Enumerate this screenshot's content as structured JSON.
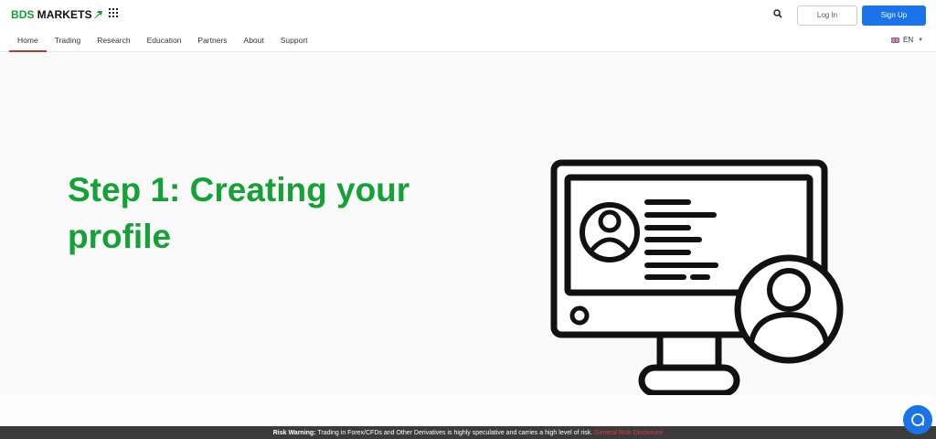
{
  "header": {
    "logo_primary": "BDS",
    "logo_secondary": "MARKETS",
    "login_label": "Log In",
    "signup_label": "Sign Up"
  },
  "nav": {
    "items": [
      {
        "label": "Home",
        "active": true
      },
      {
        "label": "Trading"
      },
      {
        "label": "Research"
      },
      {
        "label": "Education"
      },
      {
        "label": "Partners"
      },
      {
        "label": "About"
      },
      {
        "label": "Support"
      }
    ],
    "language": "EN"
  },
  "hero": {
    "headline": "Step 1: Creating your profile"
  },
  "footer": {
    "risk_label": "Risk Warning:",
    "risk_text": " Trading in Forex/CFDs and Other Derivatives is highly speculative and carries a high level of risk. ",
    "risk_link": "General Risk Disclosure"
  },
  "colors": {
    "brand_green": "#14a135",
    "primary_blue": "#1a73e8",
    "active_underline": "#c0392b",
    "footer_bg": "#3b3b3b"
  },
  "icons": [
    "apps-grid-icon",
    "search-icon",
    "uk-flag-icon",
    "chevron-down-icon",
    "chat-icon",
    "monitor-profile-illustration"
  ]
}
